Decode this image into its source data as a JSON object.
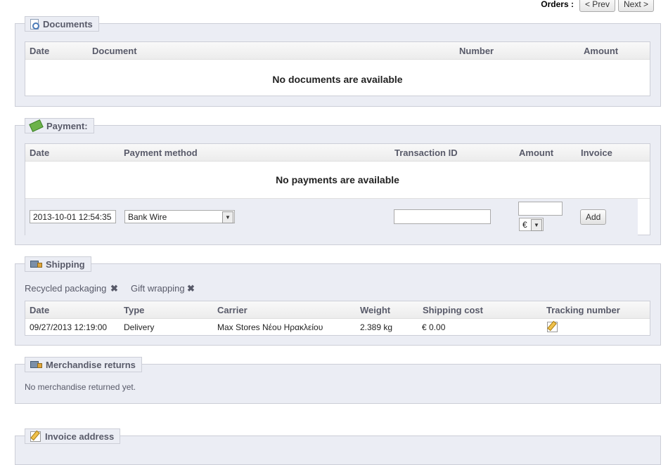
{
  "nav": {
    "label": "Orders :",
    "prev": "< Prev",
    "next": "Next >"
  },
  "documents": {
    "title": "Documents",
    "columns": [
      "Date",
      "Document",
      "Number",
      "Amount"
    ],
    "empty": "No documents are available"
  },
  "payment": {
    "title": "Payment:",
    "columns": [
      "Date",
      "Payment method",
      "Transaction ID",
      "Amount",
      "Invoice"
    ],
    "empty": "No payments are available",
    "form": {
      "date_value": "2013-10-01 12:54:35",
      "method_value": "Bank Wire",
      "transaction_value": "",
      "amount_value": "",
      "currency_value": "€",
      "add_label": "Add"
    }
  },
  "shipping": {
    "title": "Shipping",
    "recycled_label": "Recycled packaging",
    "gift_label": "Gift wrapping",
    "columns": [
      "Date",
      "Type",
      "Carrier",
      "Weight",
      "Shipping cost",
      "Tracking number"
    ],
    "rows": [
      {
        "date": "09/27/2013 12:19:00",
        "type": "Delivery",
        "carrier": "Max Stores Νέου Ηρακλείου",
        "weight": "2.389 kg",
        "cost": "€ 0.00"
      }
    ]
  },
  "returns": {
    "title": "Merchandise returns",
    "empty": "No merchandise returned yet."
  },
  "invoice": {
    "title": "Invoice address"
  }
}
